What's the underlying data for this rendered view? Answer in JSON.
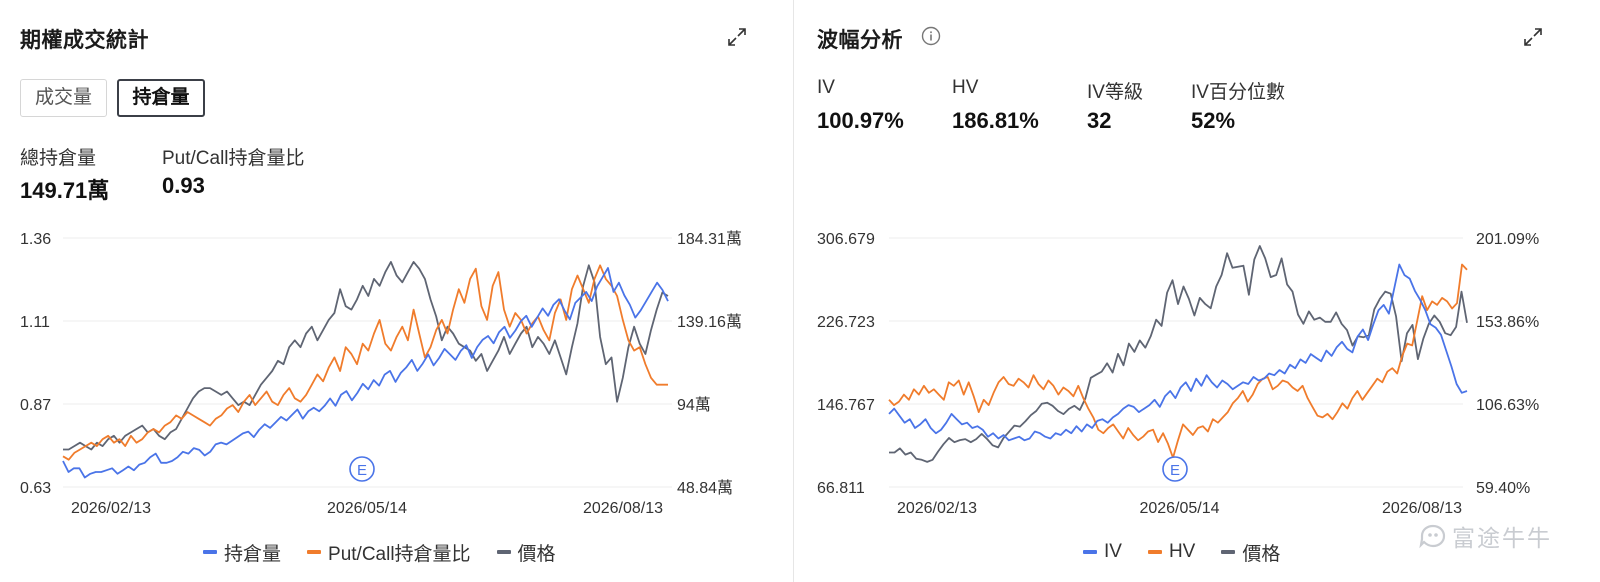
{
  "colors": {
    "blue": "#4a74e8",
    "orange": "#f07c2c",
    "gray": "#5f6573"
  },
  "left": {
    "title": "期權成交統計",
    "tabs": [
      "成交量",
      "持倉量"
    ],
    "active_tab": "持倉量",
    "stats": [
      {
        "label": "總持倉量",
        "value": "149.71萬"
      },
      {
        "label": "Put/Call持倉量比",
        "value": "0.93"
      }
    ],
    "legend": [
      "持倉量",
      "Put/Call持倉量比",
      "價格"
    ],
    "earnings_marker": "E"
  },
  "right": {
    "title": "波幅分析",
    "stats": [
      {
        "label": "IV",
        "value": "100.97%"
      },
      {
        "label": "HV",
        "value": "186.81%"
      },
      {
        "label": "IV等級",
        "value": "32"
      },
      {
        "label": "IV百分位數",
        "value": "52%"
      }
    ],
    "legend": [
      "IV",
      "HV",
      "價格"
    ],
    "earnings_marker": "E",
    "watermark": "富途牛牛"
  },
  "chart_data": [
    {
      "type": "line",
      "x_ticks": [
        "2026/02/13",
        "2026/05/14",
        "2026/08/13"
      ],
      "y_left_ticks": [
        "1.36",
        "1.11",
        "0.87",
        "0.63"
      ],
      "y_left_range": [
        0.63,
        1.36
      ],
      "y_right_ticks": [
        "184.31萬",
        "139.16萬",
        "94萬",
        "48.84萬"
      ],
      "y_right_range": [
        48.84,
        184.31
      ],
      "grid": true,
      "legend_position": "bottom",
      "series": [
        {
          "name": "持倉量",
          "axis": "right",
          "values": [
            63,
            57,
            59,
            59,
            54,
            56,
            57,
            57,
            58,
            59,
            56,
            58,
            60,
            58,
            61,
            62,
            65,
            67,
            62,
            62,
            63,
            65,
            68,
            67,
            70,
            69,
            66,
            68,
            72,
            73,
            72,
            74,
            76,
            78,
            79,
            76,
            80,
            83,
            81,
            84,
            87,
            85,
            88,
            91,
            86,
            90,
            92,
            90,
            93,
            97,
            93,
            99,
            101,
            96,
            100,
            105,
            102,
            107,
            104,
            110,
            112,
            106,
            111,
            114,
            118,
            112,
            116,
            121,
            115,
            119,
            124,
            121,
            118,
            123,
            126,
            119,
            125,
            129,
            131,
            127,
            133,
            136,
            130,
            134,
            139,
            142,
            136,
            141,
            146,
            142,
            148,
            151,
            145,
            140,
            149,
            152,
            155,
            150,
            158,
            163,
            168,
            155,
            160,
            153,
            148,
            141,
            145,
            150,
            155,
            160,
            156,
            150
          ]
        },
        {
          "name": "Put/Call持倉量比",
          "axis": "left",
          "values": [
            0.72,
            0.71,
            0.73,
            0.74,
            0.75,
            0.76,
            0.75,
            0.77,
            0.78,
            0.76,
            0.77,
            0.75,
            0.78,
            0.76,
            0.77,
            0.79,
            0.8,
            0.79,
            0.81,
            0.82,
            0.84,
            0.83,
            0.85,
            0.84,
            0.83,
            0.82,
            0.81,
            0.83,
            0.84,
            0.86,
            0.87,
            0.85,
            0.88,
            0.9,
            0.87,
            0.89,
            0.91,
            0.88,
            0.87,
            0.9,
            0.92,
            0.89,
            0.88,
            0.9,
            0.93,
            0.96,
            0.94,
            0.98,
            1.01,
            0.97,
            1.04,
            1.02,
            0.99,
            1.05,
            1.03,
            1.08,
            1.12,
            1.05,
            1.03,
            1.07,
            1.1,
            1.06,
            1.15,
            1.08,
            1.01,
            1.04,
            1.09,
            1.12,
            1.08,
            1.15,
            1.21,
            1.17,
            1.24,
            1.27,
            1.16,
            1.12,
            1.22,
            1.26,
            1.15,
            1.1,
            1.14,
            1.12,
            1.08,
            1.11,
            1.13,
            1.09,
            1.06,
            1.14,
            1.18,
            1.12,
            1.21,
            1.25,
            1.21,
            1.17,
            1.24,
            1.28,
            1.24,
            1.22,
            1.19,
            1.12,
            1.06,
            1.03,
            1.04,
            0.99,
            0.95,
            0.93,
            0.93,
            0.93
          ]
        },
        {
          "name": "價格",
          "axis": "left",
          "values": [
            0.74,
            0.74,
            0.75,
            0.76,
            0.75,
            0.74,
            0.76,
            0.75,
            0.77,
            0.78,
            0.76,
            0.78,
            0.79,
            0.8,
            0.81,
            0.79,
            0.8,
            0.78,
            0.77,
            0.79,
            0.8,
            0.83,
            0.86,
            0.89,
            0.91,
            0.92,
            0.92,
            0.91,
            0.9,
            0.91,
            0.89,
            0.87,
            0.88,
            0.87,
            0.9,
            0.93,
            0.95,
            0.97,
            1.0,
            0.99,
            1.04,
            1.06,
            1.04,
            1.08,
            1.1,
            1.06,
            1.09,
            1.12,
            1.14,
            1.21,
            1.16,
            1.15,
            1.18,
            1.22,
            1.19,
            1.24,
            1.22,
            1.26,
            1.29,
            1.25,
            1.23,
            1.26,
            1.29,
            1.27,
            1.24,
            1.18,
            1.13,
            1.06,
            1.1,
            1.08,
            1.05,
            1.04,
            1.03,
            1.0,
            1.02,
            0.97,
            1.0,
            1.03,
            1.07,
            1.02,
            1.05,
            1.08,
            1.1,
            1.04,
            1.07,
            1.05,
            1.02,
            1.06,
            1.01,
            0.96,
            1.04,
            1.11,
            1.22,
            1.28,
            1.23,
            1.07,
            0.99,
            1.01,
            0.88,
            0.95,
            1.04,
            1.1,
            1.05,
            1.02,
            1.09,
            1.15,
            1.2,
            1.19
          ]
        }
      ]
    },
    {
      "type": "line",
      "x_ticks": [
        "2026/02/13",
        "2026/05/14",
        "2026/08/13"
      ],
      "y_left_ticks": [
        "306.679",
        "226.723",
        "146.767",
        "66.811"
      ],
      "y_left_range": [
        66.811,
        306.679
      ],
      "y_right_ticks": [
        "201.09%",
        "153.86%",
        "106.63%",
        "59.40%"
      ],
      "y_right_range": [
        59.4,
        201.09
      ],
      "grid": true,
      "legend_position": "bottom",
      "series": [
        {
          "name": "IV",
          "axis": "right",
          "values": [
            101,
            104,
            100,
            96,
            98,
            93,
            95,
            98,
            93,
            90,
            92,
            96,
            101,
            98,
            95,
            96,
            93,
            94,
            92,
            88,
            90,
            87,
            89,
            86,
            87,
            88,
            86,
            87,
            91,
            90,
            88,
            87,
            90,
            89,
            92,
            90,
            94,
            91,
            95,
            93,
            97,
            98,
            96,
            99,
            101,
            104,
            106,
            105,
            102,
            104,
            106,
            109,
            105,
            111,
            114,
            110,
            116,
            119,
            114,
            121,
            117,
            123,
            119,
            116,
            120,
            118,
            115,
            117,
            119,
            118,
            122,
            120,
            121,
            124,
            123,
            126,
            124,
            129,
            127,
            132,
            130,
            135,
            133,
            131,
            137,
            134,
            139,
            142,
            138,
            136,
            145,
            149,
            143,
            152,
            160,
            163,
            158,
            172,
            186,
            180,
            178,
            171,
            166,
            160,
            152,
            150,
            146,
            137,
            128,
            118,
            113,
            114
          ]
        },
        {
          "name": "HV",
          "axis": "right",
          "values": [
            109,
            106,
            108,
            112,
            109,
            115,
            112,
            117,
            113,
            115,
            112,
            109,
            119,
            117,
            120,
            112,
            119,
            111,
            102,
            109,
            106,
            113,
            119,
            122,
            118,
            117,
            121,
            119,
            116,
            123,
            118,
            115,
            120,
            117,
            112,
            116,
            114,
            111,
            117,
            110,
            104,
            99,
            92,
            90,
            93,
            95,
            91,
            87,
            93,
            89,
            86,
            88,
            91,
            92,
            85,
            90,
            84,
            76,
            86,
            95,
            92,
            89,
            93,
            94,
            91,
            98,
            96,
            99,
            102,
            107,
            110,
            114,
            108,
            112,
            118,
            121,
            122,
            115,
            117,
            120,
            119,
            116,
            114,
            117,
            110,
            105,
            100,
            99,
            101,
            98,
            102,
            107,
            104,
            110,
            114,
            109,
            113,
            117,
            121,
            119,
            125,
            127,
            124,
            134,
            141,
            140,
            154,
            168,
            160,
            165,
            163,
            167,
            165,
            161,
            164,
            186,
            183
          ]
        },
        {
          "name": "價格",
          "axis": "left",
          "values": [
            100,
            100,
            104,
            98,
            100,
            94,
            93,
            91,
            93,
            101,
            108,
            114,
            110,
            112,
            113,
            110,
            113,
            118,
            113,
            107,
            105,
            114,
            120,
            126,
            125,
            130,
            136,
            140,
            147,
            148,
            145,
            140,
            137,
            142,
            145,
            141,
            152,
            172,
            175,
            178,
            186,
            177,
            195,
            184,
            205,
            197,
            208,
            201,
            212,
            228,
            222,
            254,
            266,
            243,
            260,
            248,
            232,
            249,
            243,
            239,
            260,
            271,
            292,
            278,
            279,
            280,
            252,
            286,
            299,
            287,
            269,
            271,
            287,
            262,
            255,
            233,
            224,
            236,
            228,
            230,
            226,
            226,
            235,
            224,
            218,
            203,
            212,
            211,
            213,
            238,
            248,
            255,
            253,
            231,
            188,
            215,
            223,
            190,
            210,
            224,
            232,
            226,
            215,
            213,
            221,
            255,
            225
          ]
        }
      ]
    }
  ]
}
